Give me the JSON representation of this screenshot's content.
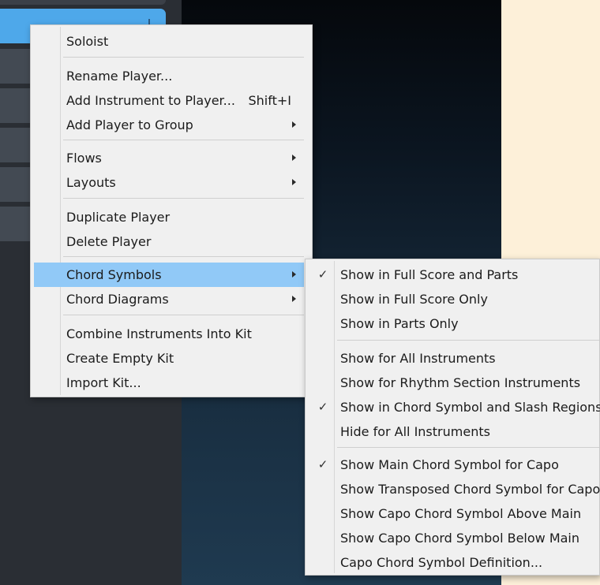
{
  "main_menu": {
    "items": [
      {
        "label": "Soloist"
      },
      {
        "label": "Rename Player..."
      },
      {
        "label": "Add Instrument to Player...",
        "shortcut": "Shift+I"
      },
      {
        "label": "Add Player to Group",
        "submenu": true
      },
      {
        "label": "Flows",
        "submenu": true
      },
      {
        "label": "Layouts",
        "submenu": true
      },
      {
        "label": "Duplicate Player"
      },
      {
        "label": "Delete Player"
      },
      {
        "label": "Chord Symbols",
        "submenu": true,
        "highlighted": true
      },
      {
        "label": "Chord Diagrams",
        "submenu": true
      },
      {
        "label": "Combine Instruments Into Kit"
      },
      {
        "label": "Create Empty Kit"
      },
      {
        "label": "Import Kit..."
      }
    ]
  },
  "chord_symbols_submenu": {
    "items": [
      {
        "label": "Show in Full Score and Parts",
        "checked": true
      },
      {
        "label": "Show in Full Score Only",
        "checked": false
      },
      {
        "label": "Show in Parts Only",
        "checked": false
      },
      {
        "label": "Show for All Instruments",
        "checked": false
      },
      {
        "label": "Show for Rhythm Section Instruments",
        "checked": false
      },
      {
        "label": "Show in Chord Symbol and Slash Regions",
        "checked": true
      },
      {
        "label": "Hide for All Instruments",
        "checked": false
      },
      {
        "label": "Show Main Chord Symbol for Capo",
        "checked": true
      },
      {
        "label": "Show Transposed Chord Symbol for Capo",
        "checked": false
      },
      {
        "label": "Show Capo Chord Symbol Above Main",
        "checked": false
      },
      {
        "label": "Show Capo Chord Symbol Below Main",
        "checked": false
      },
      {
        "label": "Capo Chord Symbol Definition...",
        "checked": false
      }
    ]
  },
  "icons": {
    "check": "checkmark-icon",
    "submenu": "submenu-arrow-icon"
  },
  "check_glyph": "✓",
  "colors": {
    "menu_bg": "#f0f0f0",
    "highlight": "#91c9f7",
    "selected_player": "#4ea8ea",
    "paper": "#fdf0d9"
  }
}
